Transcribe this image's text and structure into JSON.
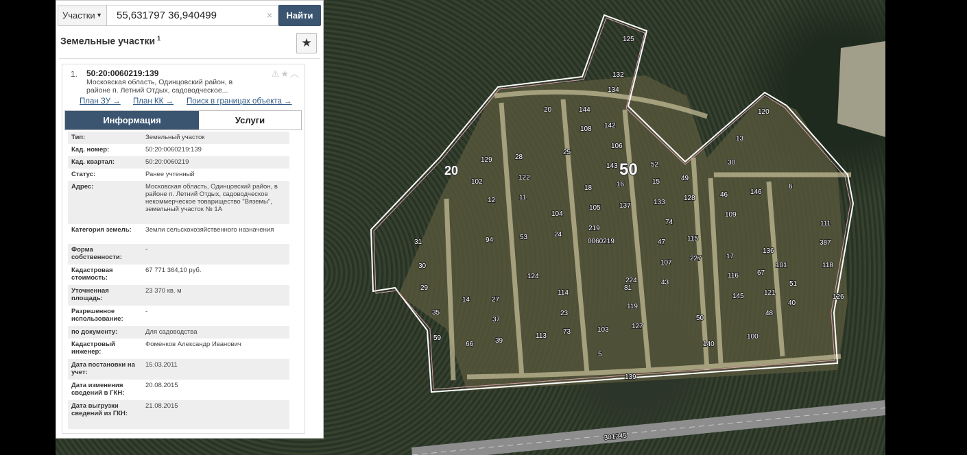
{
  "search": {
    "type_label": "Участки",
    "query": "55,631797 36,940499",
    "clear_symbol": "×",
    "button_label": "Найти"
  },
  "panel": {
    "title": "Земельные участки",
    "title_count": "1",
    "fav_symbol": "★"
  },
  "result": {
    "index": "1.",
    "cad_number": "50:20:0060219:139",
    "address_short": "Московская область, Одинцовский район, в районе п. Летний Отдых, садоводческое...",
    "icons": "⚠★︿",
    "links": [
      "План ЗУ →",
      "План КК →",
      "Поиск в границах объекта →"
    ],
    "tabs": [
      "Информация",
      "Услуги"
    ]
  },
  "info": [
    {
      "key": "Тип:",
      "value": "Земельный участок"
    },
    {
      "key": "Кад. номер:",
      "value": "50:20:0060219:139"
    },
    {
      "key": "Кад. квартал:",
      "value": "50:20:0060219"
    },
    {
      "key": "Статус:",
      "value": "Ранее учтенный"
    },
    {
      "key": "Адрес:",
      "value": "Московская область, Одинцовский район, в районе п. Летний Отдых, садоводческое некоммерческое товарищество \"Вяземы\", земельный участок № 1А"
    },
    {
      "key": "Категория земель:",
      "value": "Земли сельскохозяйственного назначения"
    },
    {
      "key": "Форма собственности:",
      "value": "-"
    },
    {
      "key": "Кадастровая стоимость:",
      "value": "67 771 364,10 руб."
    },
    {
      "key": "Уточненная площадь:",
      "value": "23 370 кв. м"
    },
    {
      "key": "Разрешенное использование:",
      "value": "-"
    },
    {
      "key": "по документу:",
      "value": "Для садоводства"
    },
    {
      "key": "Кадастровый инженер:",
      "value": "Фоменков Александр Иванович"
    },
    {
      "key": "Дата постановки на учет:",
      "value": "15.03.2011"
    },
    {
      "key": "Дата изменения сведений в ГКН:",
      "value": "20.08.2015"
    },
    {
      "key": "Дата выгрузки сведений из ГКН:",
      "value": "21.08.2015"
    }
  ],
  "map": {
    "big_labels": [
      "20",
      "50"
    ],
    "quarter_label": "0060219",
    "road_label": "301345",
    "boundary_label": "139",
    "plot_labels": [
      "125",
      "132",
      "134",
      "20",
      "144",
      "108",
      "142",
      "106",
      "25",
      "28",
      "129",
      "122",
      "102",
      "12",
      "11",
      "143",
      "16",
      "18",
      "52",
      "15",
      "49",
      "105",
      "137",
      "133",
      "128",
      "104",
      "219",
      "74",
      "53",
      "24",
      "94",
      "31",
      "30",
      "29",
      "14",
      "27",
      "37",
      "39",
      "66",
      "35",
      "59",
      "124",
      "114",
      "23",
      "73",
      "113",
      "81",
      "103",
      "5",
      "127",
      "224",
      "119",
      "115",
      "47",
      "107",
      "227",
      "43",
      "50",
      "46",
      "146",
      "109",
      "17",
      "136",
      "116",
      "67",
      "145",
      "121",
      "48",
      "101",
      "51",
      "40",
      "111",
      "387",
      "118",
      "120",
      "13",
      "6",
      "126",
      "140",
      "100",
      "30"
    ]
  }
}
